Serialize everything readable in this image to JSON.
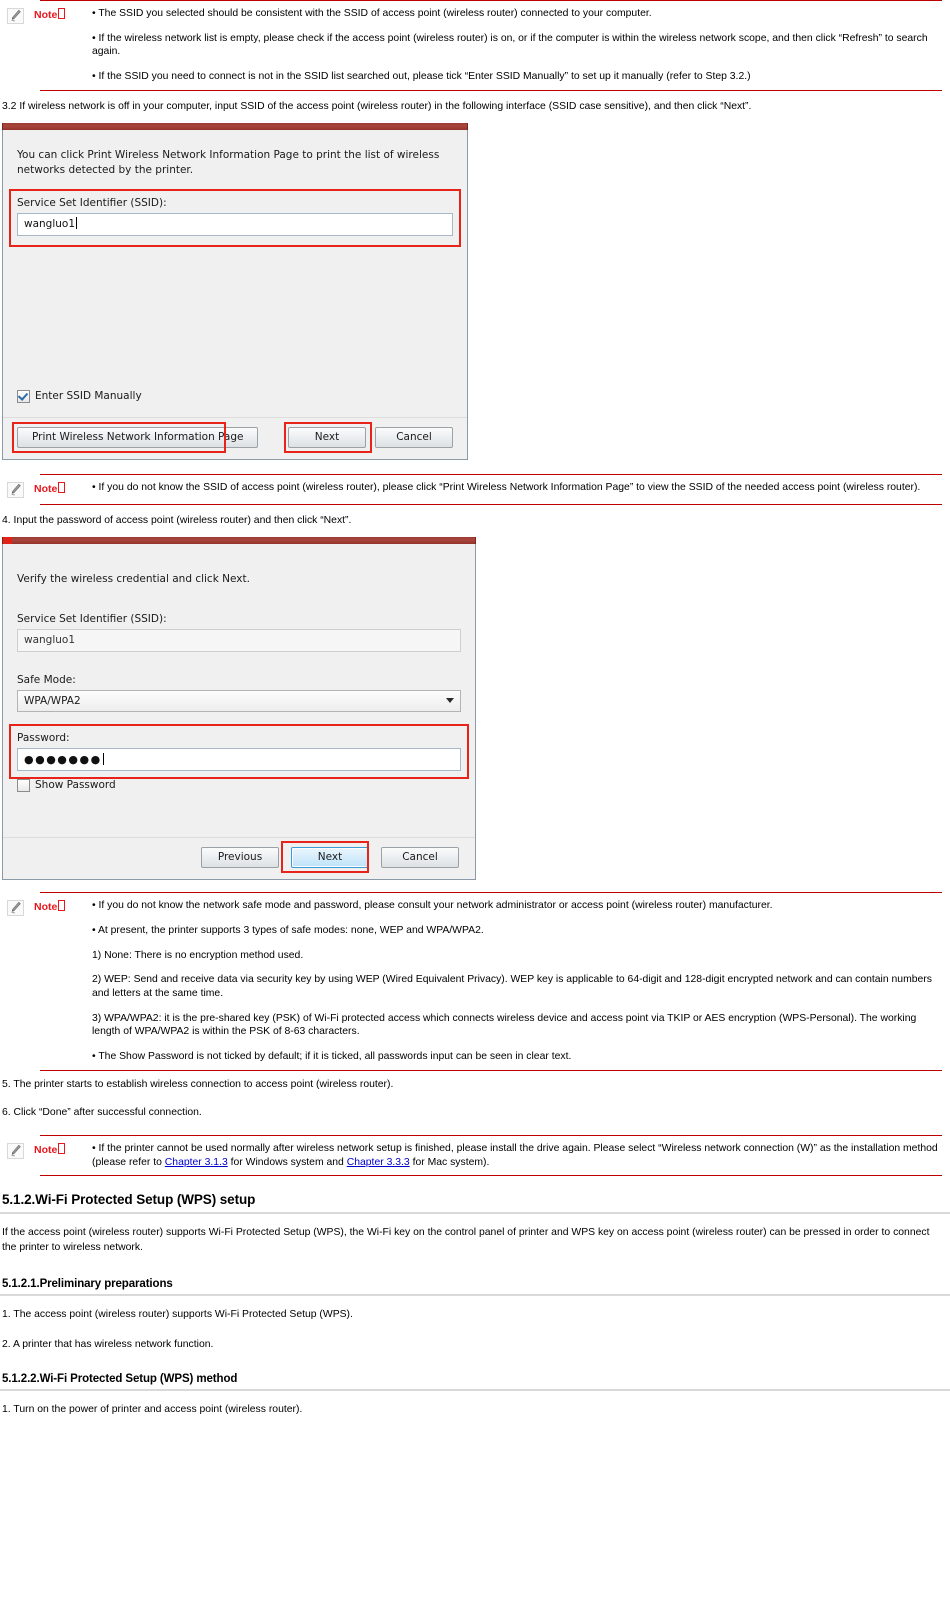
{
  "notes": {
    "label": "Note",
    "note1": {
      "items": [
        "• The SSID you selected should be consistent with the SSID of access point (wireless router) connected to your computer.",
        "• If the wireless network list is empty, please check if the access point (wireless router) is on, or if the computer is within the wireless network scope, and then click “Refresh” to search again.",
        "• If the SSID you need to connect is not in the SSID list searched out, please tick “Enter SSID Manually” to set up it manually (refer to Step 3.2.)"
      ]
    },
    "note2": {
      "items": [
        "• If you do not know the SSID of access point (wireless router), please click “Print Wireless Network Information Page” to view the SSID of the needed access point (wireless router)."
      ]
    },
    "note3": {
      "items": [
        "• If you do not know the network safe mode and password, please consult your network administrator or access point (wireless router) manufacturer.",
        "• At present, the printer supports 3 types of safe modes: none, WEP and WPA/WPA2.",
        "1) None: There is no encryption method used.",
        "2) WEP: Send and receive data via security key by using WEP (Wired Equivalent Privacy). WEP key is applicable to 64-digit and 128-digit encrypted network and can contain numbers and letters at the same time.",
        "3) WPA/WPA2: it is the pre-shared key (PSK) of Wi-Fi protected access which connects wireless device and access point via TKIP or AES encryption (WPS-Personal). The working length of WPA/WPA2 is within the PSK of 8-63 characters.",
        "• The Show Password is not ticked by default; if it is ticked, all passwords input can be seen in clear text."
      ]
    },
    "note4": {
      "prefix": "• If the printer cannot be used normally after wireless network setup is finished, please install the drive again. Please select “Wireless network connection (W)” as the installation method (please refer to ",
      "link1": "Chapter 3.1.3",
      "middle": " for Windows system and ",
      "link2": "Chapter 3.3.3",
      "suffix": " for Mac system)."
    }
  },
  "steps": {
    "step32": "3.2 If wireless network is off in your computer, input SSID of the access point (wireless router) in the following interface (SSID case sensitive), and then click “Next”.",
    "step4": "4. Input the password of access point (wireless router) and then click “Next”.",
    "step5": "5. The printer starts to establish wireless connection to access point (wireless router).",
    "step6": "6. Click “Done” after successful connection."
  },
  "dialog_ssid": {
    "intro": "You can click Print Wireless Network Information Page to print the list of wireless networks detected by the printer.",
    "ssid_label": "Service Set Identifier (SSID):",
    "ssid_value": "wangluo1",
    "checkbox_label": "Enter SSID Manually",
    "checkbox_checked": true,
    "btn_print": "Print Wireless Network Information Page",
    "btn_next": "Next",
    "btn_cancel": "Cancel"
  },
  "dialog_password": {
    "intro": "Verify the wireless credential and click Next.",
    "ssid_label": "Service Set Identifier (SSID):",
    "ssid_value": "wangluo1",
    "safe_mode_label": "Safe Mode:",
    "safe_mode_value": "WPA/WPA2",
    "password_label": "Password:",
    "password_value": "●●●●●●●",
    "show_password_label": "Show Password",
    "show_password_checked": false,
    "btn_previous": "Previous",
    "btn_next": "Next",
    "btn_cancel": "Cancel"
  },
  "sections": {
    "h512": "5.1.2.Wi-Fi Protected Setup (WPS) setup",
    "p512": "If the access point (wireless router) supports Wi-Fi Protected Setup (WPS), the Wi-Fi key on the control panel of printer and WPS key on access point (wireless router) can be pressed in order to connect the printer to wireless network.",
    "h5121": "5.1.2.1.Preliminary preparations",
    "p5121_1": "1. The access point (wireless router) supports Wi-Fi Protected Setup (WPS).",
    "p5121_2": "2. A printer that has wireless network function.",
    "h5122": "5.1.2.2.Wi-Fi Protected Setup (WPS) method",
    "p5122_1": "1. Turn on the power of printer and access point (wireless router)."
  },
  "colors": {
    "note_rule": "#c00000",
    "note_label": "#e8161d",
    "highlight_box": "#e8231a",
    "link": "#0000cd",
    "dialog_titlebar": "#9e3b34"
  }
}
